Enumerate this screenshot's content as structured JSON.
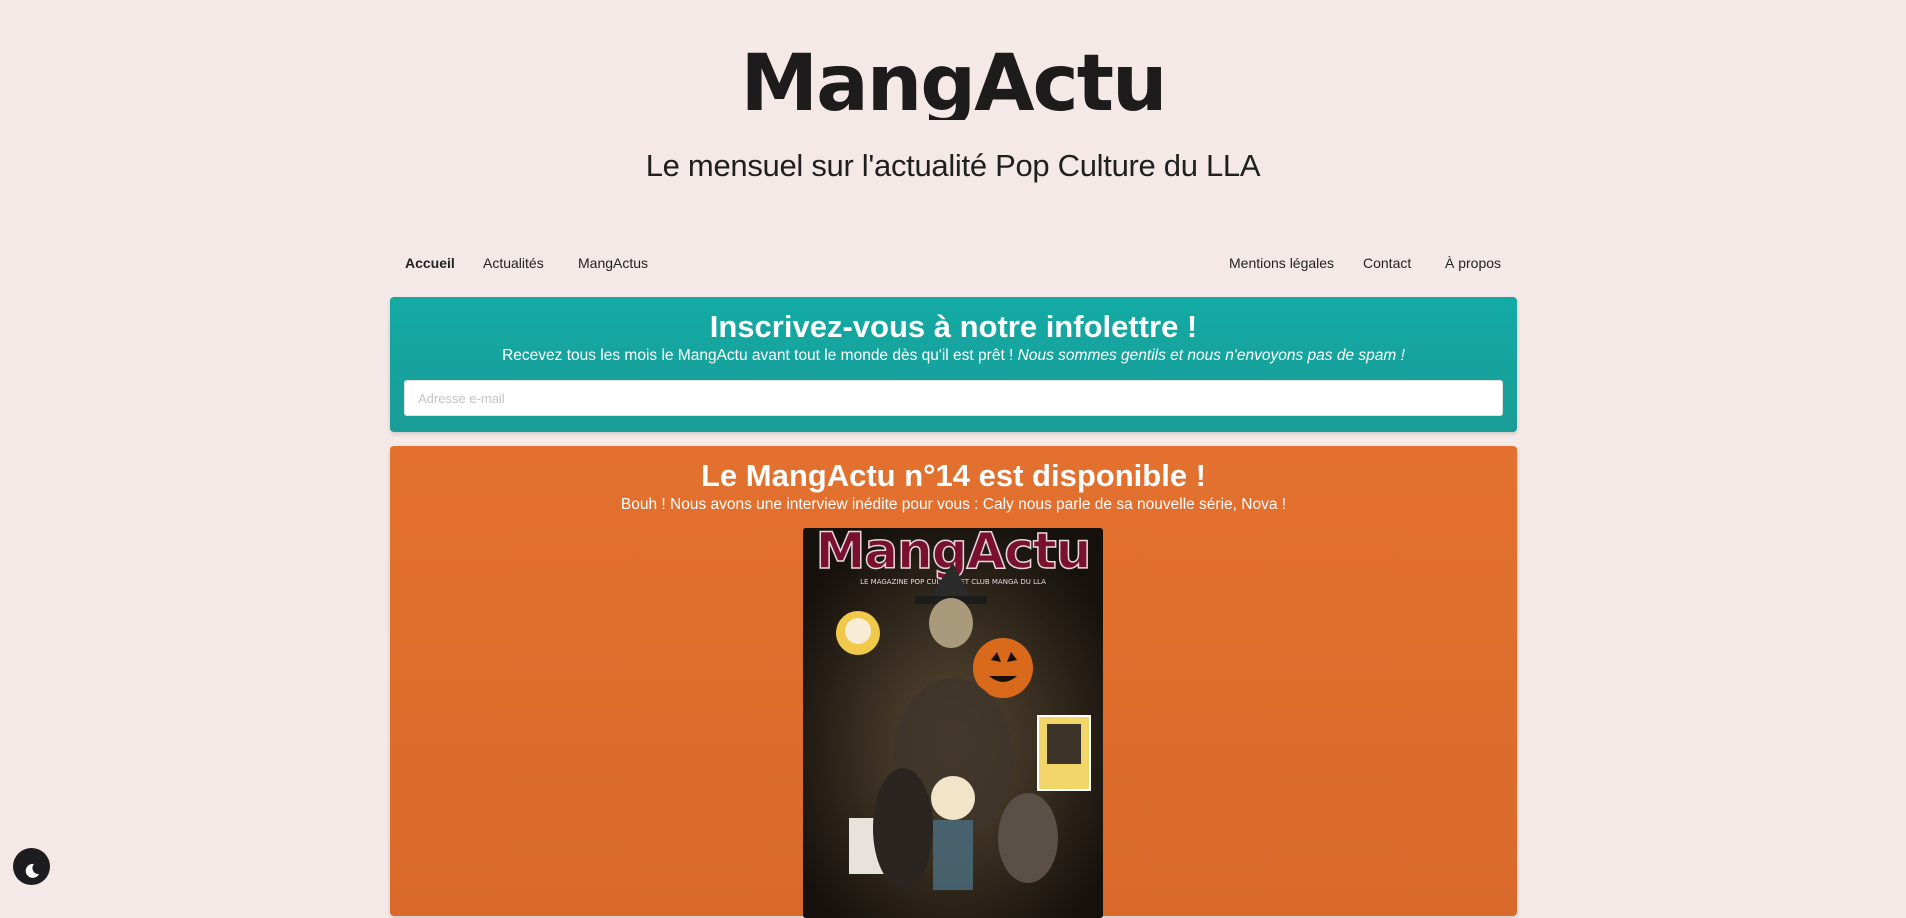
{
  "header": {
    "logo_text": "MangActu",
    "tagline": "Le mensuel sur l'actualité Pop Culture du LLA"
  },
  "nav": {
    "left": [
      {
        "label": "Accueil",
        "active": true
      },
      {
        "label": "Actualités",
        "active": false
      },
      {
        "label": "MangActus",
        "active": false
      }
    ],
    "right": [
      {
        "label": "Mentions légales"
      },
      {
        "label": "Contact"
      },
      {
        "label": "À propos"
      }
    ]
  },
  "newsletter": {
    "title": "Inscrivez-vous à notre infolettre !",
    "subtitle_plain": "Recevez tous les mois le MangActu avant tout le monde dès qu'il est prêt ! ",
    "subtitle_italic": "Nous sommes gentils et nous n'envoyons pas de spam !",
    "email_placeholder": "Adresse e-mail",
    "color": "#13aaa4"
  },
  "release": {
    "title": "Le MangActu n°14 est disponible !",
    "subtitle": "Bouh ! Nous avons une interview inédite pour vous : Caly nous parle de sa nouvelle série, Nova !",
    "color": "#e3702e",
    "cover": {
      "logo_text": "MangActu",
      "tagline": "LE MAGAZINE POP CULTURE ET CLUB MANGA DU LLA"
    }
  },
  "dark_mode_toggle": {
    "icon": "moon-icon"
  }
}
